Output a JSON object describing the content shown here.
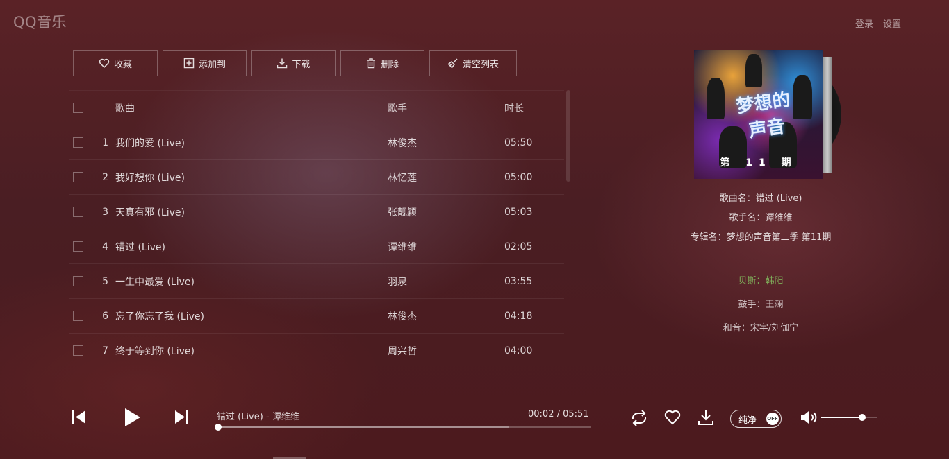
{
  "app": {
    "logo": "QQ音乐"
  },
  "top_links": {
    "login": "登录",
    "settings": "设置"
  },
  "toolbar": {
    "favorite": "收藏",
    "add_to": "添加到",
    "download": "下载",
    "delete": "删除",
    "clear_list": "清空列表"
  },
  "list": {
    "headers": {
      "song": "歌曲",
      "artist": "歌手",
      "duration": "时长"
    },
    "rows": [
      {
        "num": "1",
        "song": "我们的爱 (Live)",
        "artist": "林俊杰",
        "duration": "05:50"
      },
      {
        "num": "2",
        "song": "我好想你 (Live)",
        "artist": "林忆莲",
        "duration": "05:00"
      },
      {
        "num": "3",
        "song": "天真有邪 (Live)",
        "artist": "张靓颖",
        "duration": "05:03"
      },
      {
        "num": "4",
        "song": "错过 (Live)",
        "artist": "谭维维",
        "duration": "02:05"
      },
      {
        "num": "5",
        "song": "一生中最爱 (Live)",
        "artist": "羽泉",
        "duration": "03:55"
      },
      {
        "num": "6",
        "song": "忘了你忘了我 (Live)",
        "artist": "林俊杰",
        "duration": "04:18"
      },
      {
        "num": "7",
        "song": "终于等到你 (Live)",
        "artist": "周兴哲",
        "duration": "04:00"
      }
    ]
  },
  "album": {
    "cover_title": "梦想的声音",
    "cover_badge": "第 11 期",
    "song_name": "歌曲名：错过 (Live)",
    "artist_name": "歌手名：谭维维",
    "album_name": "专辑名：梦想的声音第二季 第11期"
  },
  "lyrics": [
    {
      "text": "贝斯：韩阳",
      "active": true
    },
    {
      "text": "鼓手：王澜",
      "active": false
    },
    {
      "text": "和音：宋宇/刘伽宁",
      "active": false
    }
  ],
  "player": {
    "now_playing": "错过 (Live) - 谭维维",
    "time": "00:02 / 05:51",
    "progress": 0.006,
    "buffered": 0.78,
    "pure_label": "纯净",
    "pure_state": "OFF",
    "volume": 0.74
  }
}
